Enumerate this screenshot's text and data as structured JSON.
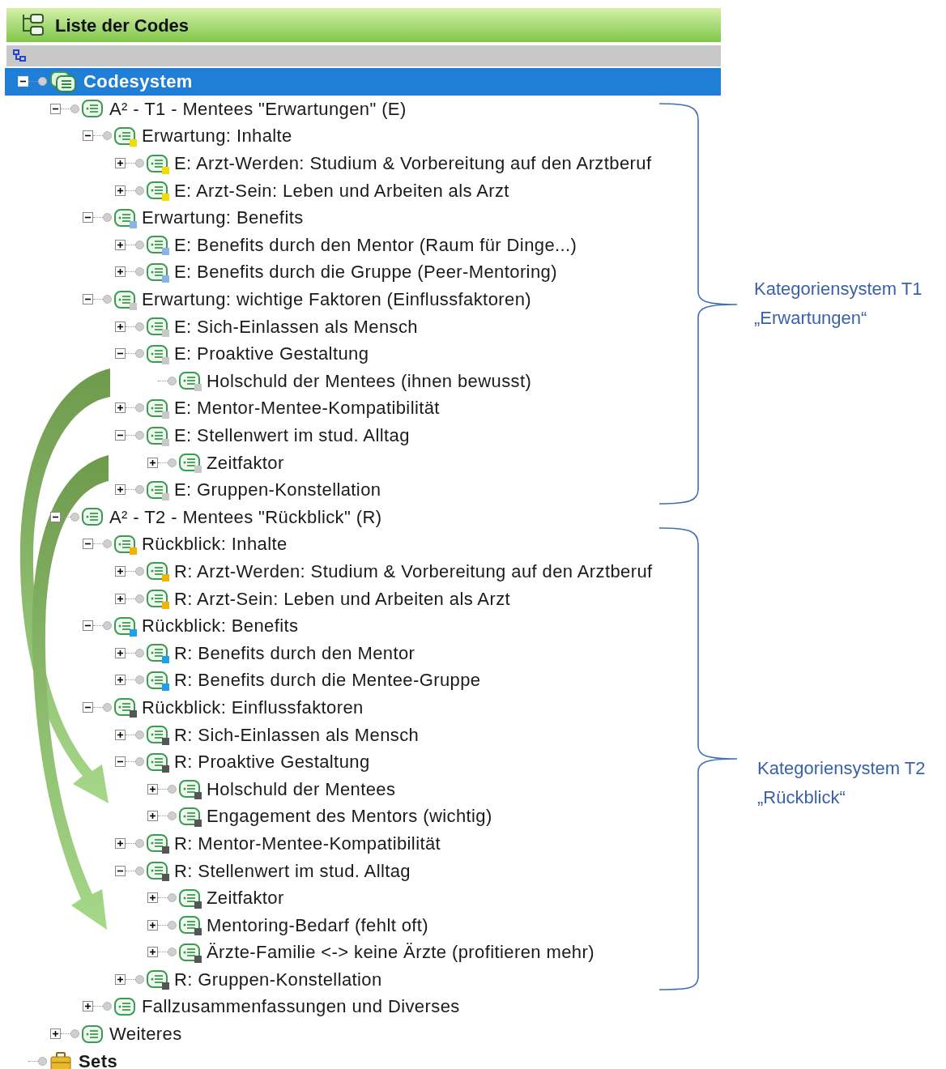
{
  "panel_title": "Liste der Codes",
  "tree": [
    {
      "label": "Codesystem",
      "kind": "codesystem",
      "selected": true,
      "expanded": true,
      "children": [
        {
          "label": "A² - T1 - Mentees \"Erwartungen\" (E)",
          "kind": "code",
          "selected": false,
          "expanded": true,
          "children": [
            {
              "label": "Erwartung: Inhalte",
              "kind": "code",
              "selected": false,
              "expanded": true,
              "color": "#f2dc00",
              "children": [
                {
                  "label": "E: Arzt-Werden: Studium & Vorbereitung auf den Arztberuf",
                  "kind": "code",
                  "selected": false,
                  "expanded": false,
                  "color": "#f2dc00"
                },
                {
                  "label": "E: Arzt-Sein: Leben und Arbeiten als Arzt",
                  "kind": "code",
                  "selected": false,
                  "expanded": false,
                  "color": "#f2dc00"
                }
              ]
            },
            {
              "label": "Erwartung: Benefits",
              "kind": "code",
              "selected": false,
              "expanded": true,
              "color": "#8ab4e6",
              "children": [
                {
                  "label": "E: Benefits durch den Mentor (Raum für Dinge...)",
                  "kind": "code",
                  "selected": false,
                  "expanded": false,
                  "color": "#8ab4e6"
                },
                {
                  "label": "E: Benefits durch die Gruppe (Peer-Mentoring)",
                  "kind": "code",
                  "selected": false,
                  "expanded": false,
                  "color": "#8ab4e6"
                }
              ]
            },
            {
              "label": "Erwartung: wichtige Faktoren (Einflussfaktoren)",
              "kind": "code",
              "selected": false,
              "expanded": true,
              "color": "#c8c8c8",
              "children": [
                {
                  "label": "E: Sich-Einlassen als Mensch",
                  "kind": "code",
                  "selected": false,
                  "expanded": false,
                  "color": "#c8c8c8"
                },
                {
                  "label": "E: Proaktive Gestaltung",
                  "kind": "code",
                  "selected": false,
                  "expanded": true,
                  "color": "#c8c8c8",
                  "children": [
                    {
                      "label": "Holschuld der Mentees (ihnen bewusst)",
                      "kind": "code",
                      "selected": false,
                      "color": "#c8c8c8"
                    }
                  ]
                },
                {
                  "label": "E: Mentor-Mentee-Kompatibilität",
                  "kind": "code",
                  "selected": false,
                  "expanded": false,
                  "color": "#c8c8c8"
                },
                {
                  "label": "E: Stellenwert im stud. Alltag",
                  "kind": "code",
                  "selected": false,
                  "expanded": true,
                  "color": "#c8c8c8",
                  "children": [
                    {
                      "label": "Zeitfaktor",
                      "kind": "code",
                      "selected": false,
                      "expanded": false,
                      "color": "#c8c8c8"
                    }
                  ]
                },
                {
                  "label": "E: Gruppen-Konstellation",
                  "kind": "code",
                  "selected": false,
                  "expanded": false,
                  "color": "#c8c8c8"
                }
              ]
            }
          ]
        },
        {
          "label": "A² - T2 - Mentees \"Rückblick\" (R)",
          "kind": "code",
          "selected": false,
          "expanded": true,
          "children": [
            {
              "label": "Rückblick: Inhalte",
              "kind": "code",
              "selected": false,
              "expanded": true,
              "color": "#f0b400",
              "children": [
                {
                  "label": "R: Arzt-Werden: Studium & Vorbereitung auf den Arztberuf",
                  "kind": "code",
                  "selected": false,
                  "expanded": false,
                  "color": "#f0b400"
                },
                {
                  "label": "R: Arzt-Sein: Leben und Arbeiten als Arzt",
                  "kind": "code",
                  "selected": false,
                  "expanded": false,
                  "color": "#f0b400"
                }
              ]
            },
            {
              "label": "Rückblick: Benefits",
              "kind": "code",
              "selected": false,
              "expanded": true,
              "color": "#1ea0e6",
              "children": [
                {
                  "label": "R: Benefits durch den Mentor",
                  "kind": "code",
                  "selected": false,
                  "expanded": false,
                  "color": "#1ea0e6"
                },
                {
                  "label": "R: Benefits durch die Mentee-Gruppe",
                  "kind": "code",
                  "selected": false,
                  "expanded": false,
                  "color": "#1ea0e6"
                }
              ]
            },
            {
              "label": "Rückblick: Einflussfaktoren",
              "kind": "code",
              "selected": false,
              "expanded": true,
              "color": "#555555",
              "children": [
                {
                  "label": "R: Sich-Einlassen als Mensch",
                  "kind": "code",
                  "selected": false,
                  "expanded": false,
                  "color": "#555555"
                },
                {
                  "label": "R: Proaktive Gestaltung",
                  "kind": "code",
                  "selected": false,
                  "expanded": true,
                  "color": "#555555",
                  "children": [
                    {
                      "label": "Holschuld der Mentees",
                      "kind": "code",
                      "selected": false,
                      "expanded": false,
                      "color": "#555555"
                    },
                    {
                      "label": "Engagement des Mentors (wichtig)",
                      "kind": "code",
                      "selected": false,
                      "expanded": false,
                      "color": "#555555"
                    }
                  ]
                },
                {
                  "label": "R: Mentor-Mentee-Kompatibilität",
                  "kind": "code",
                  "selected": false,
                  "expanded": false,
                  "color": "#555555"
                },
                {
                  "label": "R: Stellenwert im stud. Alltag",
                  "kind": "code",
                  "selected": false,
                  "expanded": true,
                  "color": "#555555",
                  "children": [
                    {
                      "label": "Zeitfaktor",
                      "kind": "code",
                      "selected": false,
                      "expanded": false,
                      "color": "#555555"
                    },
                    {
                      "label": "Mentoring-Bedarf (fehlt oft)",
                      "kind": "code",
                      "selected": false,
                      "expanded": false,
                      "color": "#555555"
                    },
                    {
                      "label": "Ärzte-Familie <-> keine Ärzte (profitieren mehr)",
                      "kind": "code",
                      "selected": false,
                      "expanded": false,
                      "color": "#555555"
                    }
                  ]
                },
                {
                  "label": "R: Gruppen-Konstellation",
                  "kind": "code",
                  "selected": false,
                  "expanded": false,
                  "color": "#555555"
                }
              ]
            },
            {
              "label": "Fallzusammenfassungen und Diverses",
              "kind": "code",
              "selected": false,
              "expanded": false
            }
          ]
        },
        {
          "label": "Weiteres",
          "kind": "code",
          "selected": false,
          "expanded": false
        }
      ]
    },
    {
      "label": "Sets",
      "kind": "set",
      "selected": false
    }
  ],
  "annotations": [
    {
      "lines": [
        "Kategoriensystem T1",
        "„Erwartungen“"
      ]
    },
    {
      "lines": [
        "Kategoriensystem T2",
        "„Rückblick“"
      ]
    }
  ]
}
